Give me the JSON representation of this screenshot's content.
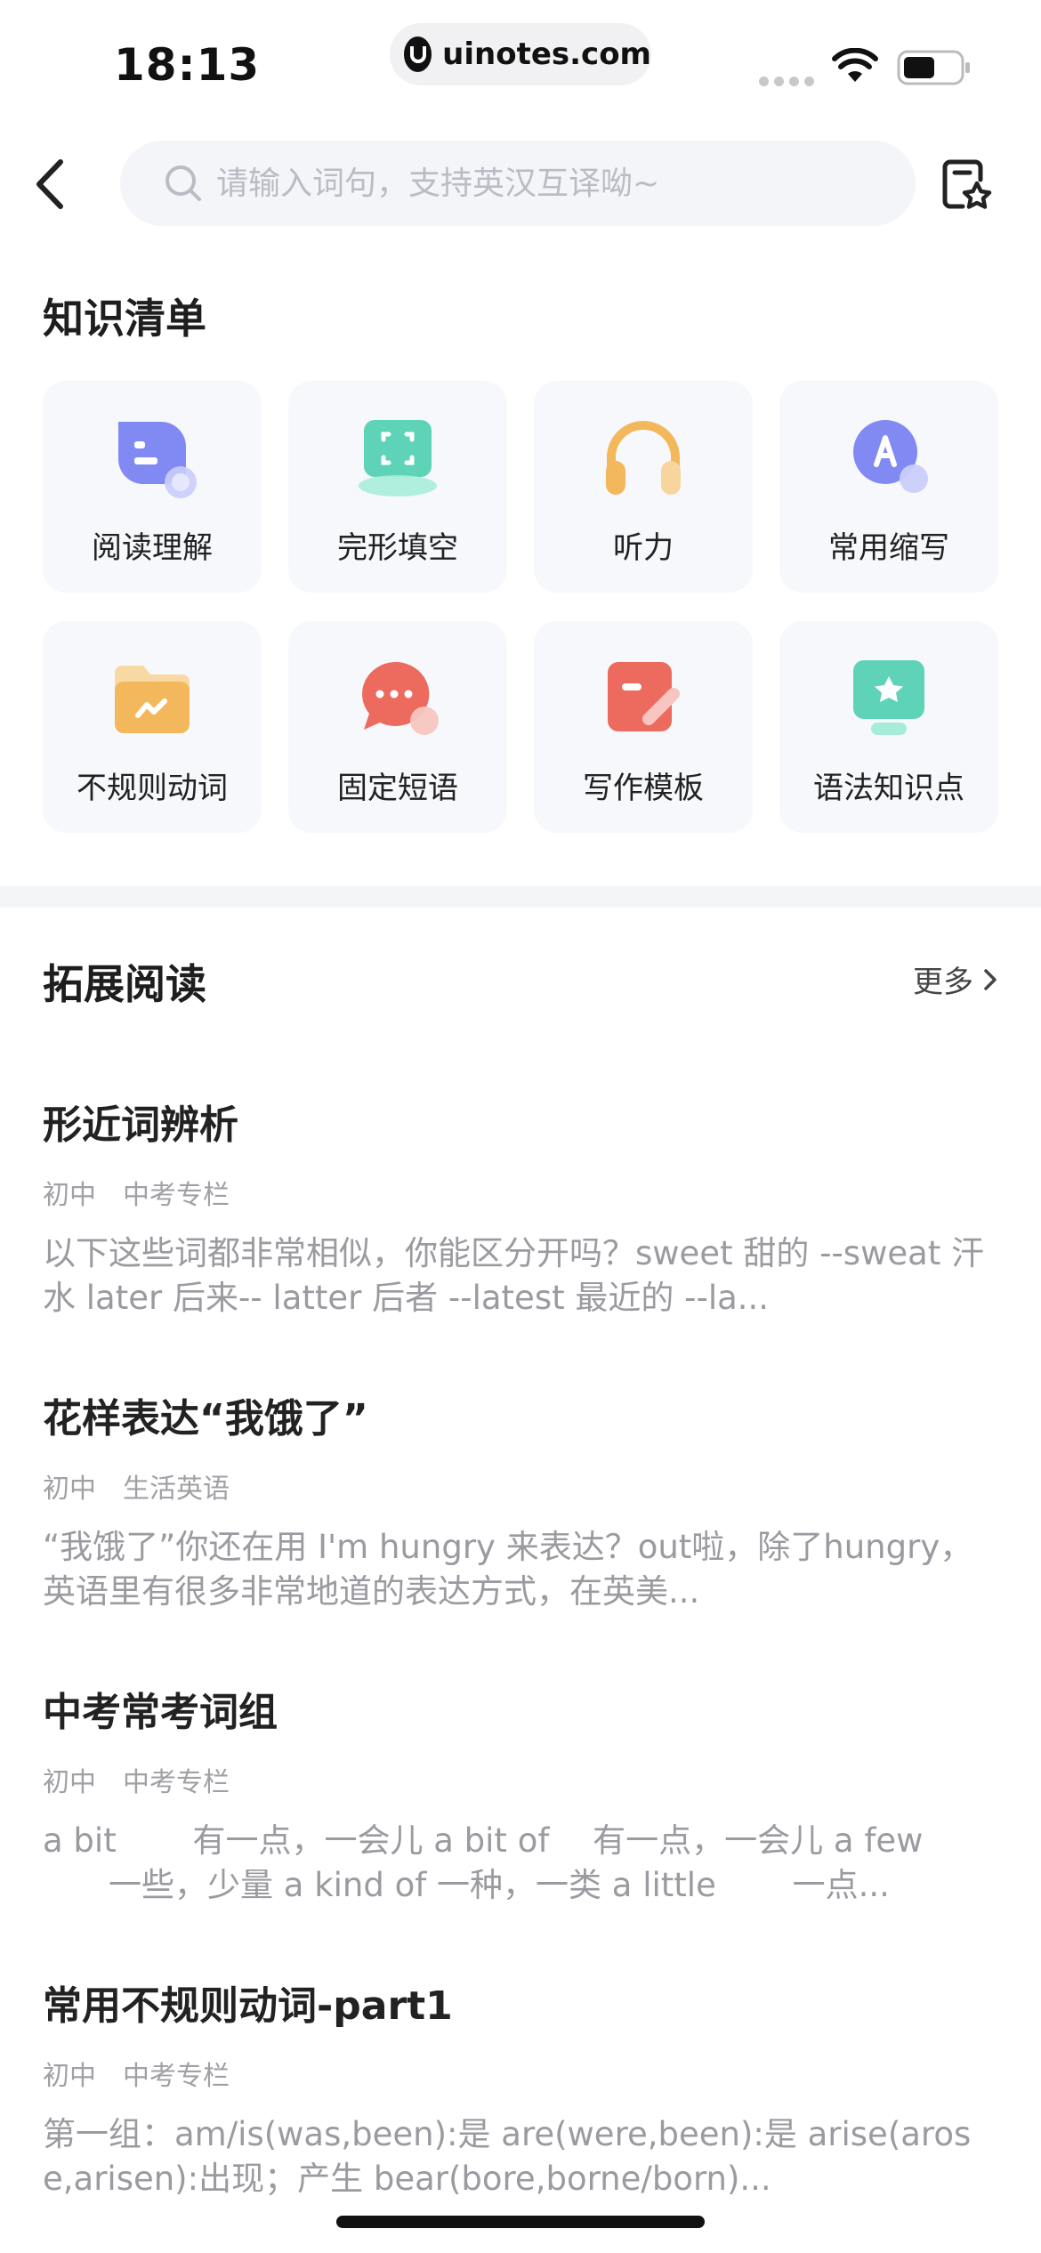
{
  "status_bar": {
    "time": "18:13",
    "url": "uinotes.com",
    "icons": [
      "signal-icon",
      "wifi-icon",
      "battery-icon"
    ]
  },
  "header": {
    "search_placeholder": "请输入词句，支持英汉互译呦~",
    "icons": [
      "back-icon",
      "search-icon",
      "bookmark-star-icon"
    ]
  },
  "knowledge": {
    "title": "知识清单",
    "items": [
      {
        "label": "阅读理解",
        "icon": "reading-icon",
        "color": "#8189f2"
      },
      {
        "label": "完形填空",
        "icon": "cloze-icon",
        "color": "#5fd3b8"
      },
      {
        "label": "听力",
        "icon": "headphones-icon",
        "color": "#f3b85b"
      },
      {
        "label": "常用缩写",
        "icon": "abbreviation-icon",
        "color": "#8189f2"
      },
      {
        "label": "不规则动词",
        "icon": "folder-icon",
        "color": "#f3b85b"
      },
      {
        "label": "固定短语",
        "icon": "chat-icon",
        "color": "#ec6a5e"
      },
      {
        "label": "写作模板",
        "icon": "writing-icon",
        "color": "#ec6a5e"
      },
      {
        "label": "语法知识点",
        "icon": "grammar-icon",
        "color": "#5fd3b8"
      }
    ]
  },
  "reading": {
    "title": "拓展阅读",
    "more": "更多",
    "articles": [
      {
        "title": "形近词辨析",
        "tags": [
          "初中",
          "中考专栏"
        ],
        "desc": "以下这些词都非常相似，你能区分开吗？sweet 甜的 --sweat 汗水 later 后来-- latter 后者 --latest 最近的 --la..."
      },
      {
        "title": "花样表达“我饿了”",
        "tags": [
          "初中",
          "生活英语"
        ],
        "desc": "“我饿了”你还在用 I'm hungry 来表达？out啦，除了hungry，英语里有很多非常地道的表达方式，在英美..."
      },
      {
        "title": "中考常考词组",
        "tags": [
          "初中",
          "中考专栏"
        ],
        "desc": "a bit 　　有一点，一会儿 a bit of 　有一点，一会儿 a few 　　一些，少量 a kind of 一种，一类 a little 　　一点..."
      },
      {
        "title": "常用不规则动词-part1",
        "tags": [
          "初中",
          "中考专栏"
        ],
        "desc": "第一组：am/is(was,been):是 are(were,been):是 arise(arose,arisen):出现；产生 bear(bore,borne/born)..."
      }
    ]
  }
}
